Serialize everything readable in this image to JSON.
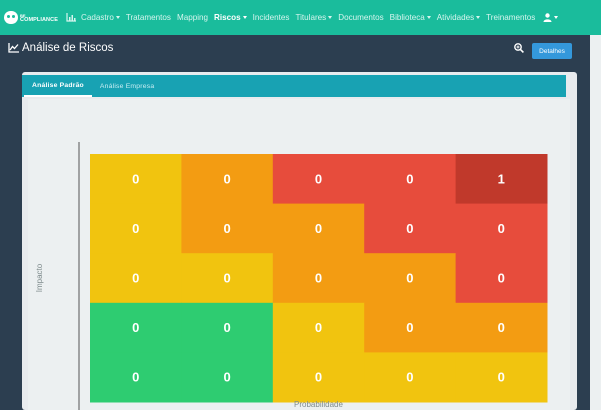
{
  "navbar": {
    "logo": {
      "line1": "BE",
      "line2": "COMPLIANCE"
    },
    "items": [
      {
        "label": "Cadastro",
        "dropdown": true,
        "active": false
      },
      {
        "label": "Tratamentos",
        "dropdown": false,
        "active": false
      },
      {
        "label": "Mapping",
        "dropdown": false,
        "active": false
      },
      {
        "label": "Riscos",
        "dropdown": true,
        "active": true
      },
      {
        "label": "Incidentes",
        "dropdown": false,
        "active": false
      },
      {
        "label": "Titulares",
        "dropdown": true,
        "active": false
      },
      {
        "label": "Documentos",
        "dropdown": false,
        "active": false
      },
      {
        "label": "Biblioteca",
        "dropdown": true,
        "active": false
      },
      {
        "label": "Atividades",
        "dropdown": true,
        "active": false
      },
      {
        "label": "Treinamentos",
        "dropdown": false,
        "active": false
      }
    ],
    "user_icon": "user-icon"
  },
  "page": {
    "title": "Análise de Riscos",
    "title_icon": "area-chart-icon",
    "zoom_icon": "search-plus-icon",
    "details_label": "Detalhes"
  },
  "tabs": [
    {
      "label": "Análise Padrão",
      "active": true
    },
    {
      "label": "Análise Empresa",
      "active": false
    }
  ],
  "chart_data": {
    "type": "heatmap",
    "xlabel": "Probabilidade",
    "ylabel": "Impacto",
    "rows": [
      {
        "values": [
          0,
          0,
          0,
          0,
          1
        ],
        "colors": [
          "#f1c40f",
          "#f39c12",
          "#e74c3c",
          "#e74c3c",
          "#c0392b"
        ]
      },
      {
        "values": [
          0,
          0,
          0,
          0,
          0
        ],
        "colors": [
          "#f1c40f",
          "#f39c12",
          "#f39c12",
          "#e74c3c",
          "#e74c3c"
        ]
      },
      {
        "values": [
          0,
          0,
          0,
          0,
          0
        ],
        "colors": [
          "#f1c40f",
          "#f1c40f",
          "#f39c12",
          "#f39c12",
          "#e74c3c"
        ]
      },
      {
        "values": [
          0,
          0,
          0,
          0,
          0
        ],
        "colors": [
          "#2ecc71",
          "#2ecc71",
          "#f1c40f",
          "#f39c12",
          "#f39c12"
        ]
      },
      {
        "values": [
          0,
          0,
          0,
          0,
          0
        ],
        "colors": [
          "#2ecc71",
          "#2ecc71",
          "#f1c40f",
          "#f1c40f",
          "#f1c40f"
        ]
      }
    ]
  }
}
